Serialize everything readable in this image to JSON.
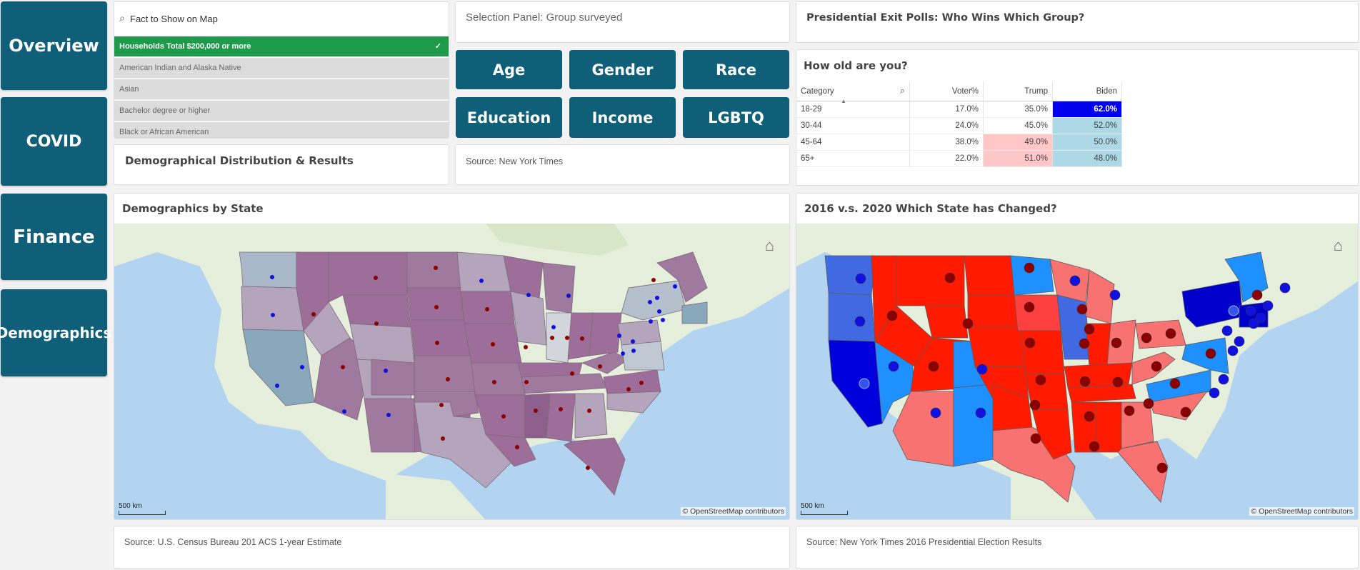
{
  "nav": [
    "Overview",
    "COVID",
    "Finance",
    "Demographics"
  ],
  "fact_list": {
    "search_label": "Fact to Show on Map",
    "items": [
      "Households Total $200,000 or more",
      "American Indian and Alaska Native",
      "Asian",
      "Bachelor degree or higher",
      "Black or African American"
    ],
    "check_icon": "✓"
  },
  "demog_title": "Demographical Distribution & Results",
  "selection": {
    "title": "Selection Panel: Group surveyed",
    "buttons": [
      "Age",
      "Gender",
      "Race",
      "Education",
      "Income",
      "LGBTQ"
    ],
    "source": "Source: New York Times"
  },
  "exit_polls": {
    "title": "Presidential Exit Polls: Who Wins Which Group?",
    "question": "How old are you?",
    "columns": [
      "Category",
      "Voter%",
      "Trump",
      "Biden"
    ],
    "rows": [
      [
        "18-29",
        "17.0%",
        "35.0%",
        "62.0%"
      ],
      [
        "30-44",
        "24.0%",
        "45.0%",
        "52.0%"
      ],
      [
        "45-64",
        "38.0%",
        "49.0%",
        "50.0%"
      ],
      [
        "65+",
        "22.0%",
        "51.0%",
        "48.0%"
      ]
    ],
    "colors": {
      "trump_highlight": "#ffc7c7",
      "biden_light": "#add8e6",
      "biden_strong": "#0000ee"
    }
  },
  "map_left": {
    "title": "Demographics by State",
    "scale": "500 km",
    "attribution": "© OpenStreetMap contributors",
    "source": "Source: U.S. Census Bureau 201 ACS 1-year Estimate"
  },
  "map_right": {
    "title": "2016 v.s. 2020 Which State has Changed?",
    "scale": "500 km",
    "attribution": "© OpenStreetMap contributors",
    "source": "Source: New York Times 2016 Presidential Election Results"
  },
  "icons": {
    "home": "⌂",
    "search": "⌕",
    "sort": "▲"
  }
}
